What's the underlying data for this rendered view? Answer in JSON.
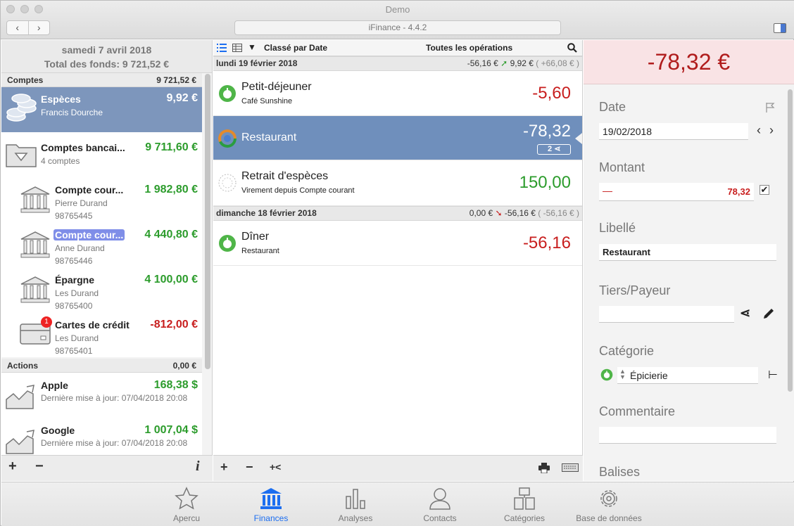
{
  "window": {
    "title": "Demo",
    "app_title": "iFinance - 4.4.2"
  },
  "left": {
    "date": "samedi 7 avril 2018",
    "total": "Total des fonds: 9 721,52 €",
    "accounts_section": {
      "label": "Comptes",
      "amount": "9 721,52 €"
    },
    "accounts": [
      {
        "name": "Espèces",
        "sub": "Francis Dourche",
        "amount": "9,92 €"
      },
      {
        "name": "Comptes bancai...",
        "sub": "4 comptes",
        "amount": "9 711,60 €"
      },
      {
        "name": "Compte cour...",
        "sub": "Pierre Durand",
        "num": "98765445",
        "amount": "1 982,80 €"
      },
      {
        "name": "Compte cour...",
        "sub": "Anne Durand",
        "num": "98765446",
        "amount": "4 440,80 €"
      },
      {
        "name": "Épargne",
        "sub": "Les Durand",
        "num": "98765400",
        "amount": "4 100,00 €"
      },
      {
        "name": "Cartes de crédit",
        "sub": "Les Durand",
        "num": "98765401",
        "amount": "-812,00 €",
        "badge": "1"
      }
    ],
    "actions_section": {
      "label": "Actions",
      "amount": "0,00 €"
    },
    "stocks": [
      {
        "name": "Apple",
        "sub": "Dernière mise à jour: 07/04/2018 20:08",
        "amount": "168,38 $"
      },
      {
        "name": "Google",
        "sub": "Dernière mise à jour: 07/04/2018 20:08",
        "amount": "1 007,04 $"
      }
    ],
    "footer": {
      "add": "+",
      "remove": "−",
      "info": "i"
    }
  },
  "middle": {
    "sort_label": "Classé par Date",
    "filter_label": "Toutes les opérations",
    "days": [
      {
        "label": "lundi 19 février 2018",
        "a": "-56,16 €",
        "b": "9,92 €",
        "c": "( +66,08 € )"
      },
      {
        "label": "dimanche 18 février 2018",
        "a": "0,00 €",
        "b": "-56,16 €",
        "c": "( -56,16 € )"
      }
    ],
    "transactions": [
      {
        "name": "Petit-déjeuner",
        "sub": "Café Sunshine",
        "amount": "-5,60"
      },
      {
        "name": "Restaurant",
        "sub": "",
        "amount": "-78,32",
        "split_count": "2"
      },
      {
        "name": "Retrait d'espèces",
        "sub": "Virement depuis Compte courant",
        "amount": "150,00"
      },
      {
        "name": "Dîner",
        "sub": "Restaurant",
        "amount": "-56,16"
      }
    ],
    "footer": {
      "add": "+",
      "remove": "−",
      "split": "+<"
    }
  },
  "detail": {
    "amount": "-78,32 €",
    "date_label": "Date",
    "date_value": "19/02/2018",
    "amount_label": "Montant",
    "amount_sign": "—",
    "amount_value": "78,32",
    "label_label": "Libellé",
    "label_value": "Restaurant",
    "payee_label": "Tiers/Payeur",
    "payee_value": "",
    "category_label": "Catégorie",
    "category_value": "Épicierie",
    "comment_label": "Commentaire",
    "comment_value": "",
    "tags_label": "Balises"
  },
  "tabs": [
    "Apercu",
    "Finances",
    "Analyses",
    "Contacts",
    "Catégories",
    "Base de données"
  ],
  "colors": {
    "accent": "#1c6ef0",
    "positive": "#2c9c2c",
    "negative": "#c81e1e",
    "selection": "#7d96bc"
  }
}
